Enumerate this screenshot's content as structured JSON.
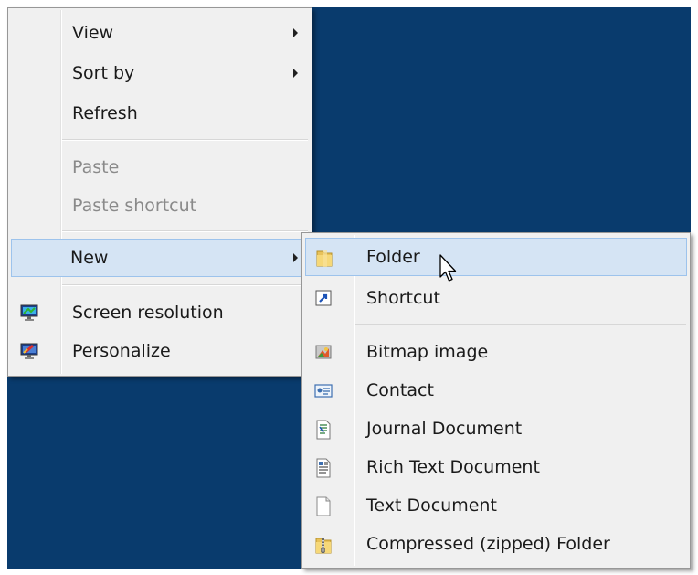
{
  "desktop": {
    "background_color": "#093b6d"
  },
  "context_menu": {
    "items": [
      {
        "label": "View",
        "submenu": true
      },
      {
        "label": "Sort by",
        "submenu": true
      },
      {
        "label": "Refresh"
      },
      {
        "label": "Paste",
        "disabled": true
      },
      {
        "label": "Paste shortcut",
        "disabled": true
      },
      {
        "label": "New",
        "submenu": true,
        "highlighted": true
      },
      {
        "label": "Screen resolution",
        "icon": "monitor-display-icon"
      },
      {
        "label": "Personalize",
        "icon": "monitor-personalize-icon"
      }
    ]
  },
  "new_submenu": {
    "items": [
      {
        "label": "Folder",
        "icon": "folder-icon",
        "highlighted": true
      },
      {
        "label": "Shortcut",
        "icon": "shortcut-icon"
      },
      {
        "label": "Bitmap image",
        "icon": "bitmap-image-icon"
      },
      {
        "label": "Contact",
        "icon": "contact-card-icon"
      },
      {
        "label": "Journal Document",
        "icon": "journal-document-icon"
      },
      {
        "label": "Rich Text Document",
        "icon": "rich-text-document-icon"
      },
      {
        "label": "Text Document",
        "icon": "text-document-icon"
      },
      {
        "label": "Compressed (zipped) Folder",
        "icon": "zipped-folder-icon"
      }
    ]
  },
  "colors": {
    "highlight_fill": "#d5e4f4",
    "highlight_border": "#9dc3ec",
    "menu_background": "#f0f0f0",
    "disabled_text": "#8a8a8a"
  }
}
